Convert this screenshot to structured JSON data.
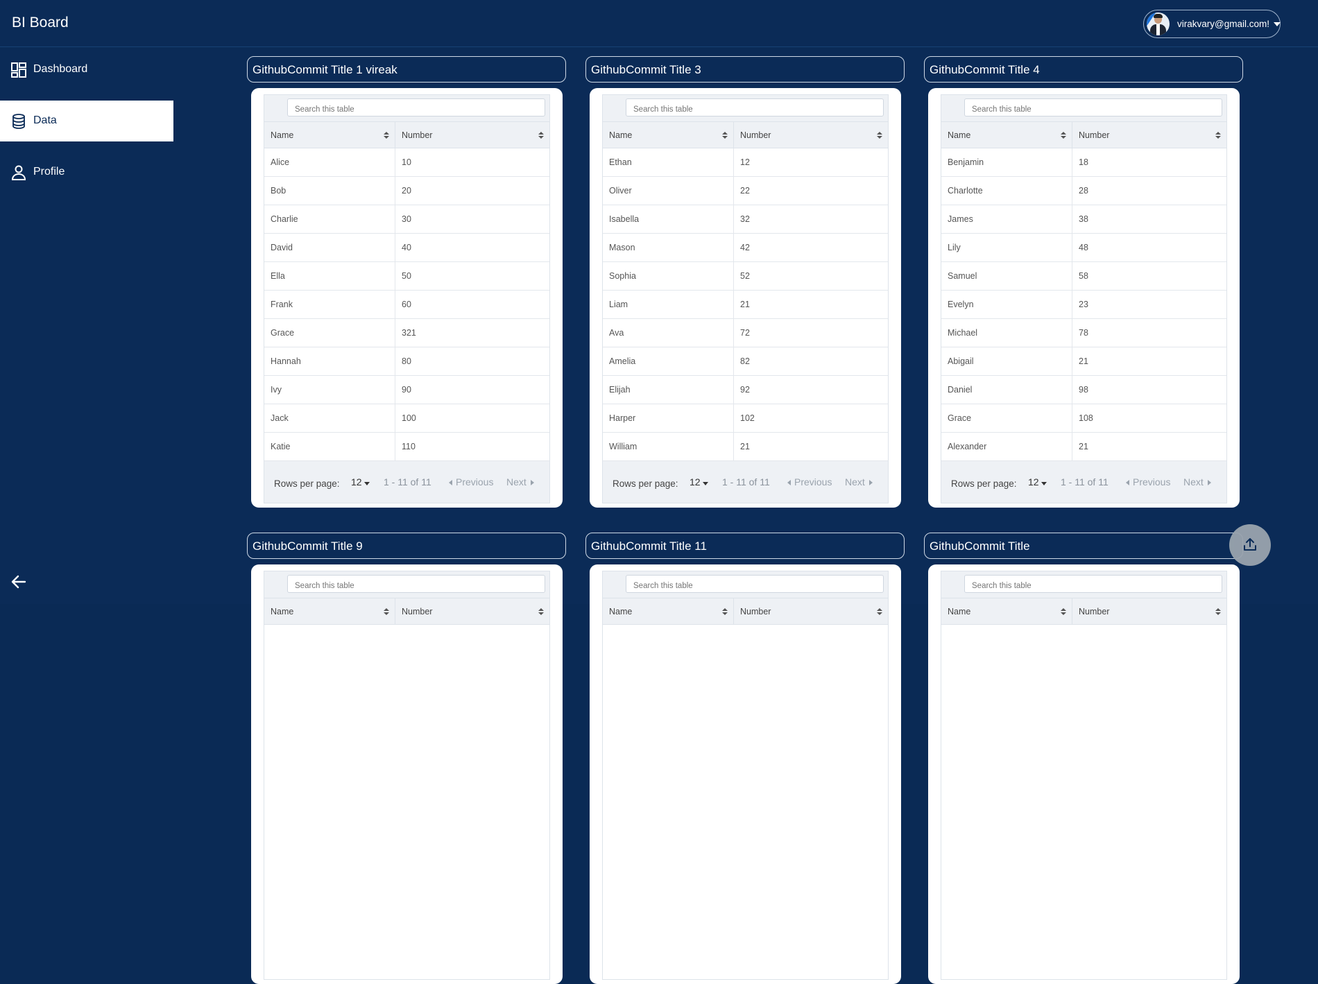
{
  "app": {
    "title": "BI Board"
  },
  "user": {
    "email": "virakvary@gmail.com!",
    "avatar": "user-avatar"
  },
  "sidebar": {
    "items": [
      {
        "label": "Dashboard",
        "icon": "dashboard-icon",
        "active": false
      },
      {
        "label": "Data",
        "icon": "database-icon",
        "active": true
      },
      {
        "label": "Profile",
        "icon": "person-icon",
        "active": false
      }
    ],
    "collapse_icon": "arrow-left-icon"
  },
  "table_ui": {
    "search_placeholder": "Search this table",
    "col_name": "Name",
    "col_number": "Number",
    "rows_per_page_label": "Rows per page:",
    "rows_per_page_value": "12",
    "range": "1 - 11 of 11",
    "previous": "Previous",
    "next": "Next"
  },
  "panels": [
    {
      "title": "GithubCommit Title 1 vireak",
      "rows": [
        [
          "Alice",
          "10"
        ],
        [
          "Bob",
          "20"
        ],
        [
          "Charlie",
          "30"
        ],
        [
          "David",
          "40"
        ],
        [
          "Ella",
          "50"
        ],
        [
          "Frank",
          "60"
        ],
        [
          "Grace",
          "321"
        ],
        [
          "Hannah",
          "80"
        ],
        [
          "Ivy",
          "90"
        ],
        [
          "Jack",
          "100"
        ],
        [
          "Katie",
          "110"
        ]
      ]
    },
    {
      "title": "GithubCommit Title 3",
      "rows": [
        [
          "Ethan",
          "12"
        ],
        [
          "Oliver",
          "22"
        ],
        [
          "Isabella",
          "32"
        ],
        [
          "Mason",
          "42"
        ],
        [
          "Sophia",
          "52"
        ],
        [
          "Liam",
          "21"
        ],
        [
          "Ava",
          "72"
        ],
        [
          "Amelia",
          "82"
        ],
        [
          "Elijah",
          "92"
        ],
        [
          "Harper",
          "102"
        ],
        [
          "William",
          "21"
        ]
      ]
    },
    {
      "title": "GithubCommit Title 4",
      "rows": [
        [
          "Benjamin",
          "18"
        ],
        [
          "Charlotte",
          "28"
        ],
        [
          "James",
          "38"
        ],
        [
          "Lily",
          "48"
        ],
        [
          "Samuel",
          "58"
        ],
        [
          "Evelyn",
          "23"
        ],
        [
          "Michael",
          "78"
        ],
        [
          "Abigail",
          "21"
        ],
        [
          "Daniel",
          "98"
        ],
        [
          "Grace",
          "108"
        ],
        [
          "Alexander",
          "21"
        ]
      ]
    },
    {
      "title": "GithubCommit Title 9",
      "rows": []
    },
    {
      "title": "GithubCommit Title 11",
      "rows": []
    },
    {
      "title": "GithubCommit Title",
      "rows": []
    }
  ],
  "fab": {
    "icon": "upload-icon"
  },
  "colors": {
    "background": "#0b2b57",
    "card": "#ffffff",
    "active_nav": "#ffffff"
  }
}
